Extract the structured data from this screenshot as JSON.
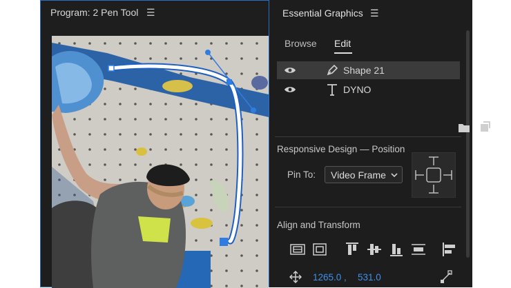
{
  "program_monitor": {
    "title": "Program: 2 Pen Tool",
    "menu_icon": "hamburger-icon"
  },
  "essential_graphics": {
    "title": "Essential Graphics",
    "menu_icon": "hamburger-icon",
    "tabs": [
      {
        "label": "Browse",
        "active": false
      },
      {
        "label": "Edit",
        "active": true
      }
    ],
    "layers": [
      {
        "name": "Shape 21",
        "type_icon": "pen-icon",
        "visible": true,
        "selected": true
      },
      {
        "name": "DYNO",
        "type_icon": "text-icon",
        "visible": true,
        "selected": false
      }
    ],
    "responsive_design": {
      "heading": "Responsive Design — Position",
      "pin_label": "Pin To:",
      "pin_value": "Video Frame"
    },
    "align_transform": {
      "heading": "Align and Transform",
      "position_x": "1265.0 ,",
      "position_y": "531.0"
    }
  },
  "colors": {
    "accent_blue": "#3d91ec",
    "panel_bg": "#1d1d1d",
    "selection": "#3b3b3b",
    "active_panel_border": "#2f6fc0"
  }
}
